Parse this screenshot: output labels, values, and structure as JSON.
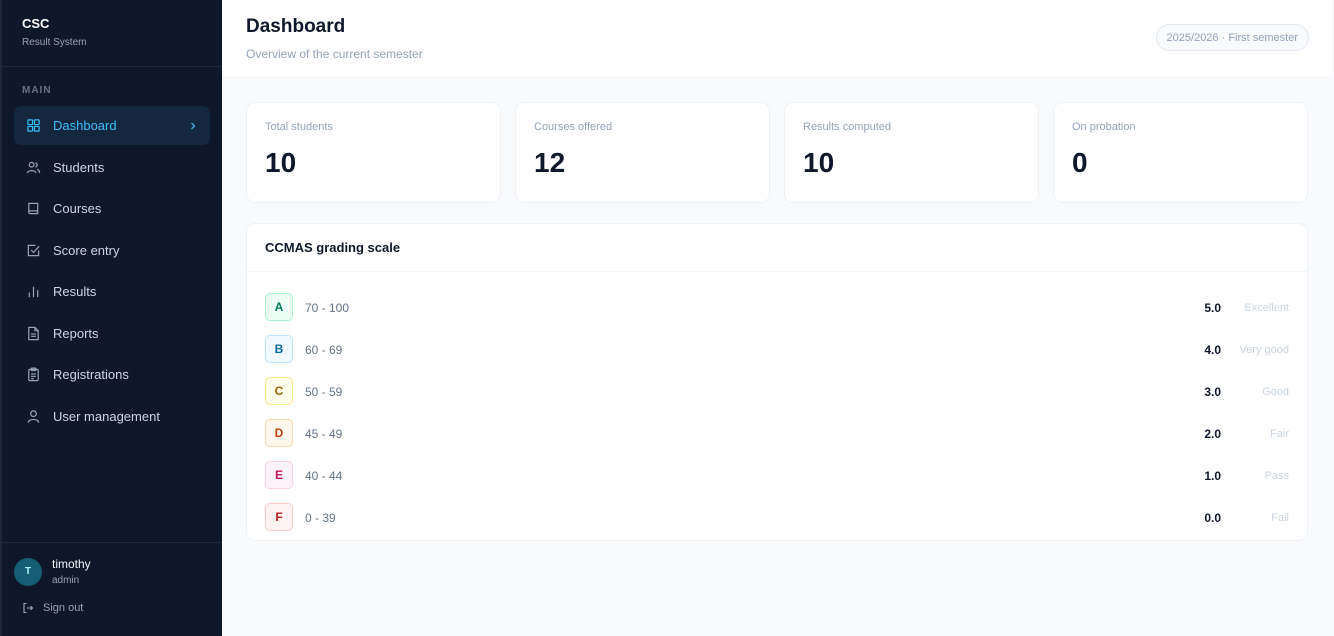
{
  "brand": {
    "name": "CSC",
    "subtitle": "Result System"
  },
  "sidebar": {
    "section_label": "MAIN",
    "items": [
      {
        "label": "Dashboard",
        "icon": "grid-icon",
        "active": true
      },
      {
        "label": "Students",
        "icon": "users-icon"
      },
      {
        "label": "Courses",
        "icon": "book-icon"
      },
      {
        "label": "Score entry",
        "icon": "check-square-icon"
      },
      {
        "label": "Results",
        "icon": "bar-chart-icon"
      },
      {
        "label": "Reports",
        "icon": "file-text-icon"
      },
      {
        "label": "Registrations",
        "icon": "clipboard-icon"
      },
      {
        "label": "User management",
        "icon": "user-icon"
      }
    ],
    "active_color": "#38bdf8"
  },
  "user": {
    "initial": "T",
    "name": "timothy",
    "role": "admin",
    "sign_out": "Sign out"
  },
  "header": {
    "title": "Dashboard",
    "subtitle": "Overview of the current semester",
    "semester": "2025/2026 · First semester"
  },
  "stats": [
    {
      "label": "Total students",
      "value": "10"
    },
    {
      "label": "Courses offered",
      "value": "12"
    },
    {
      "label": "Results computed",
      "value": "10"
    },
    {
      "label": "On probation",
      "value": "0"
    }
  ],
  "grading": {
    "title": "CCMAS grading scale",
    "rows": [
      {
        "grade": "A",
        "range": "70 - 100",
        "point": "5.0",
        "remark": "Excellent",
        "bg": "#ecfdf5",
        "border": "#a7f3d0",
        "color": "#047857"
      },
      {
        "grade": "B",
        "range": "60 - 69",
        "point": "4.0",
        "remark": "Very good",
        "bg": "#f0f9ff",
        "border": "#bae6fd",
        "color": "#0369a1"
      },
      {
        "grade": "C",
        "range": "50 - 59",
        "point": "3.0",
        "remark": "Good",
        "bg": "#fefce8",
        "border": "#fde68a",
        "color": "#a16207"
      },
      {
        "grade": "D",
        "range": "45 - 49",
        "point": "2.0",
        "remark": "Fair",
        "bg": "#fff7ed",
        "border": "#fed7aa",
        "color": "#c2410c"
      },
      {
        "grade": "E",
        "range": "40 - 44",
        "point": "1.0",
        "remark": "Pass",
        "bg": "#fdf2f8",
        "border": "#fbcfe8",
        "color": "#be185d"
      },
      {
        "grade": "F",
        "range": "0 - 39",
        "point": "0.0",
        "remark": "Fail",
        "bg": "#fef2f2",
        "border": "#fecaca",
        "color": "#b91c1c"
      }
    ]
  }
}
